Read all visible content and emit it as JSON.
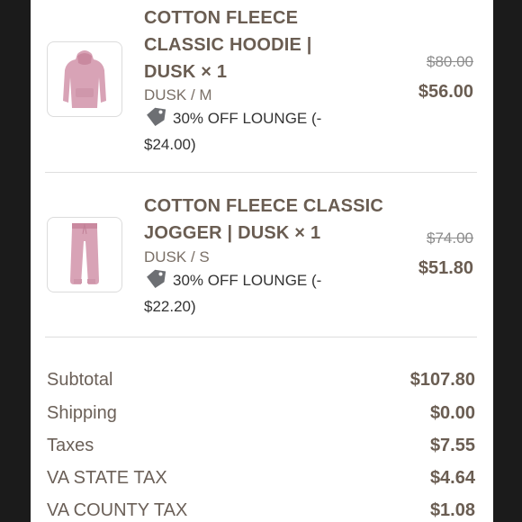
{
  "items": [
    {
      "title_lines": [
        "COTTON FLEECE",
        "CLASSIC HOODIE |",
        "DUSK × 1"
      ],
      "variant": "DUSK / M",
      "discount_line1": "30% OFF LOUNGE (-",
      "discount_line2": "$24.00)",
      "original_price": "$80.00",
      "price": "$56.00",
      "thumbnail": "hoodie-image",
      "product_color": "#d8a3b6"
    },
    {
      "title_lines": [
        "COTTON FLEECE CLASSIC",
        "JOGGER | DUSK × 1"
      ],
      "variant": "DUSK / S",
      "discount_line1": "30% OFF LOUNGE (-",
      "discount_line2": "$22.20)",
      "original_price": "$74.00",
      "price": "$51.80",
      "thumbnail": "jogger-image",
      "product_color": "#d8a3b6"
    }
  ],
  "summary": [
    {
      "label": "Subtotal",
      "value": "$107.80"
    },
    {
      "label": "Shipping",
      "value": "$0.00"
    },
    {
      "label": "Taxes",
      "value": "$7.55"
    },
    {
      "label": "VA STATE TAX",
      "value": "$4.64"
    },
    {
      "label": "VA COUNTY TAX",
      "value": "$1.08"
    }
  ],
  "colors": {
    "background": "#1b1b1b",
    "panel": "#ffffff",
    "title": "#6a5d52",
    "muted": "#7a6f66",
    "tag_icon": "#6d6f73"
  }
}
